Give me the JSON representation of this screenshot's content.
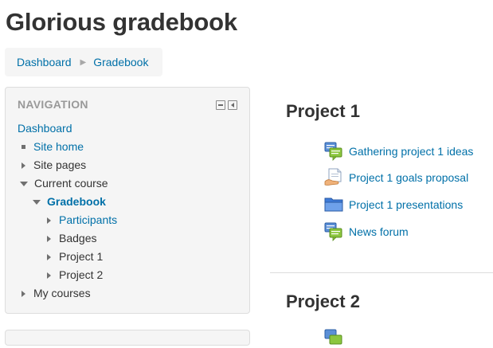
{
  "page": {
    "title": "Glorious gradebook"
  },
  "breadcrumb": {
    "items": [
      "Dashboard",
      "Gradebook"
    ]
  },
  "navigation": {
    "header": "NAVIGATION",
    "dashboard": "Dashboard",
    "site_home": "Site home",
    "site_pages": "Site pages",
    "current_course": "Current course",
    "gradebook": "Gradebook",
    "participants": "Participants",
    "badges": "Badges",
    "project1": "Project 1",
    "project2": "Project 2",
    "my_courses": "My courses"
  },
  "sections": [
    {
      "title": "Project 1",
      "activities": [
        {
          "label": "Gathering project 1 ideas",
          "icon": "forum-icon"
        },
        {
          "label": "Project 1 goals proposal",
          "icon": "assignment-icon"
        },
        {
          "label": "Project 1 presentations",
          "icon": "folder-icon"
        },
        {
          "label": "News forum",
          "icon": "forum-icon"
        }
      ]
    },
    {
      "title": "Project 2",
      "activities": []
    }
  ],
  "colors": {
    "link": "#0070a8",
    "text": "#333333",
    "block_bg": "#f5f5f5",
    "header_gray": "#999999"
  }
}
